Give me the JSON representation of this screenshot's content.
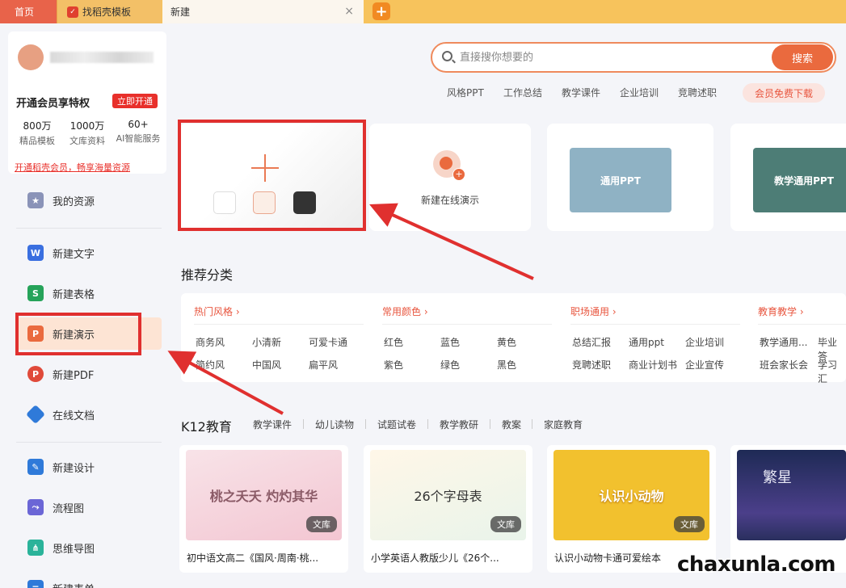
{
  "tabs": {
    "home": "首页",
    "daoke": "找稻壳模板",
    "current": "新建",
    "close": "×",
    "add": "+"
  },
  "member": {
    "vip_text": "开通会员享特权",
    "vip_button": "立即开通",
    "stats": [
      {
        "num": "800万",
        "label": "精品模板"
      },
      {
        "num": "1000万",
        "label": "文库资料"
      },
      {
        "num": "60+",
        "label": "AI智能服务"
      }
    ],
    "promo_link": "开通稻壳会员，畅享海量资源"
  },
  "sidebar": {
    "items": [
      {
        "label": "我的资源",
        "icon": "star-icon",
        "color": "#8a93b8"
      },
      {
        "label": "新建文字",
        "icon": "W",
        "color": "#3a6fe0"
      },
      {
        "label": "新建表格",
        "icon": "S",
        "color": "#26a35a"
      },
      {
        "label": "新建演示",
        "icon": "P",
        "color": "#ea6a3e"
      },
      {
        "label": "新建PDF",
        "icon": "pdf-icon",
        "color": "#e04a3a"
      },
      {
        "label": "在线文档",
        "icon": "cube-icon",
        "color": "#2f7ad9"
      },
      {
        "label": "新建设计",
        "icon": "design-icon",
        "color": "#2f7ad9"
      },
      {
        "label": "流程图",
        "icon": "flow-icon",
        "color": "#6b66d6"
      },
      {
        "label": "思维导图",
        "icon": "mindmap-icon",
        "color": "#2ab39a"
      },
      {
        "label": "新建表单",
        "icon": "form-icon",
        "color": "#2f7ad9"
      }
    ]
  },
  "search": {
    "placeholder": "直接搜你想要的",
    "button": "搜索",
    "hot": [
      "风格PPT",
      "工作总结",
      "教学课件",
      "企业培训",
      "竞聘述职"
    ],
    "vip_download": "会员免费下载"
  },
  "create": {
    "online_label": "新建在线演示",
    "templates": [
      "通用PPT",
      "教学通用PPT"
    ],
    "swatch_colors": [
      "#ffffff",
      "#fbeee6",
      "#333333"
    ]
  },
  "recommend": {
    "title": "推荐分类",
    "groups": [
      {
        "head": "热门风格",
        "items": [
          "商务风",
          "小清新",
          "可爱卡通",
          "简约风",
          "中国风",
          "扁平风"
        ]
      },
      {
        "head": "常用颜色",
        "items": [
          "红色",
          "蓝色",
          "黄色",
          "紫色",
          "绿色",
          "黑色"
        ]
      },
      {
        "head": "职场通用",
        "items": [
          "总结汇报",
          "通用ppt",
          "企业培训",
          "竞聘述职",
          "商业计划书",
          "企业宣传"
        ]
      },
      {
        "head": "教育教学",
        "items": [
          "教学通用...",
          "毕业答",
          "班会家长会",
          "学习汇"
        ]
      }
    ]
  },
  "k12": {
    "title": "K12教育",
    "tabs": [
      "教学课件",
      "幼儿读物",
      "试题试卷",
      "教学教研",
      "教案",
      "家庭教育"
    ],
    "cards": [
      {
        "thumb": "桃之夭夭 灼灼其华",
        "badge": "文库",
        "title": "初中语文高二《国风·周南·桃..."
      },
      {
        "thumb": "26个字母表",
        "badge": "文库",
        "title": "小学英语人教版少儿《26个..."
      },
      {
        "thumb": "认识小动物",
        "badge": "文库",
        "title": "认识小动物卡通可爱绘本"
      },
      {
        "thumb": "繁星",
        "badge": "",
        "title": ""
      }
    ]
  },
  "watermark": "chaxunla.com"
}
